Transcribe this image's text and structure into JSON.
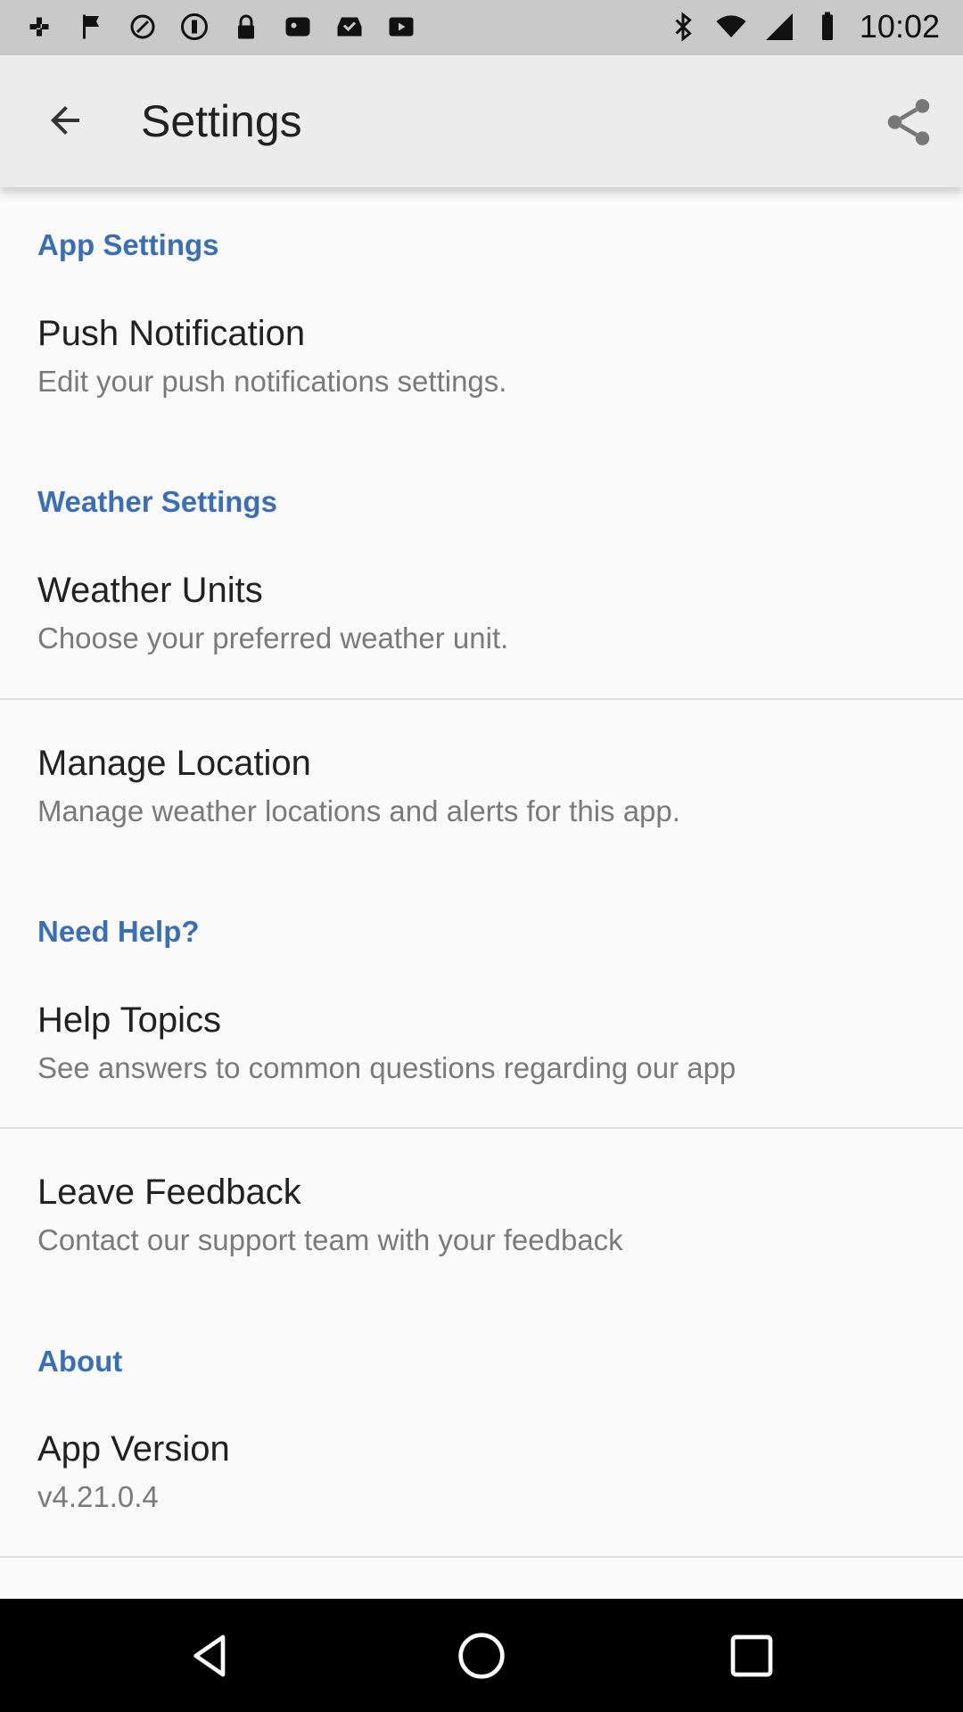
{
  "status_bar": {
    "time": "10:02",
    "left_icons": [
      "slack-icon",
      "flag-icon",
      "fake-gps-icon",
      "signal-circle-icon",
      "lock-icon",
      "photo-icon",
      "inbox-check-icon",
      "play-icon"
    ],
    "right_icons": [
      "bluetooth-icon",
      "wifi-icon",
      "cell-signal-icon",
      "battery-icon"
    ]
  },
  "app_bar": {
    "title": "Settings"
  },
  "sections": [
    {
      "header": "App Settings",
      "items": [
        {
          "title": "Push Notification",
          "subtitle": "Edit your push notifications settings."
        }
      ]
    },
    {
      "header": "Weather Settings",
      "items": [
        {
          "title": "Weather Units",
          "subtitle": "Choose your preferred weather unit."
        },
        {
          "title": "Manage Location",
          "subtitle": "Manage weather locations and alerts for this app."
        }
      ]
    },
    {
      "header": "Need Help?",
      "items": [
        {
          "title": "Help Topics",
          "subtitle": "See answers to common questions regarding our app"
        },
        {
          "title": "Leave Feedback",
          "subtitle": "Contact our support team with your feedback"
        }
      ]
    },
    {
      "header": "About",
      "items": [
        {
          "title": "App Version",
          "subtitle": "v4.21.0.4"
        }
      ]
    }
  ],
  "colors": {
    "accent": "#3a6fb7",
    "app_bar": "#ececec",
    "status_bar": "#c9c9c9",
    "background": "#fafafa"
  }
}
